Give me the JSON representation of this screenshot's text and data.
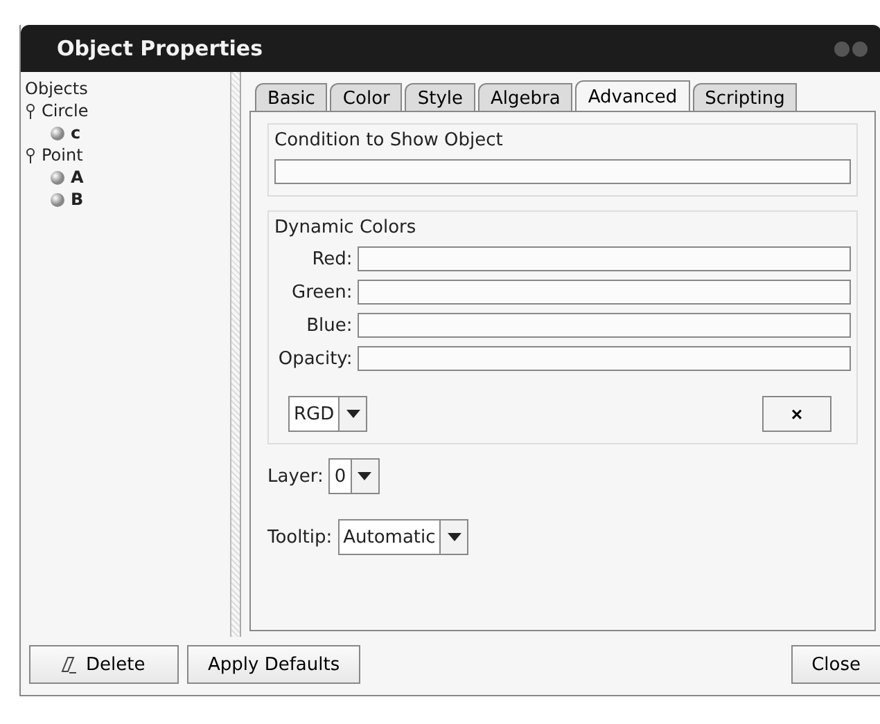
{
  "window": {
    "title": "Object Properties"
  },
  "tree": {
    "label": "Objects",
    "children": [
      {
        "label": "Circle",
        "expanded": true,
        "children": [
          {
            "label": "c"
          }
        ]
      },
      {
        "label": "Point",
        "expanded": true,
        "children": [
          {
            "label": "A"
          },
          {
            "label": "B"
          }
        ]
      }
    ]
  },
  "tabs": [
    {
      "label": "Basic",
      "selected": false
    },
    {
      "label": "Color",
      "selected": false
    },
    {
      "label": "Style",
      "selected": false
    },
    {
      "label": "Algebra",
      "selected": false
    },
    {
      "label": "Advanced",
      "selected": true
    },
    {
      "label": "Scripting",
      "selected": false
    }
  ],
  "condition": {
    "title": "Condition to Show Object"
  },
  "dynamic_colors": {
    "title": "Dynamic Colors",
    "fields": [
      {
        "label": "Red:"
      },
      {
        "label": "Green:"
      },
      {
        "label": "Blue:"
      },
      {
        "label": "Opacity:"
      }
    ],
    "mode": "RGD",
    "clear_button": "×"
  },
  "layer": {
    "label": "Layer:",
    "value": "0"
  },
  "tooltip": {
    "label": "Tooltip:",
    "value": "Automatic"
  },
  "buttons": {
    "delete": "Delete",
    "apply": "Apply Defaults",
    "close": "Close"
  }
}
